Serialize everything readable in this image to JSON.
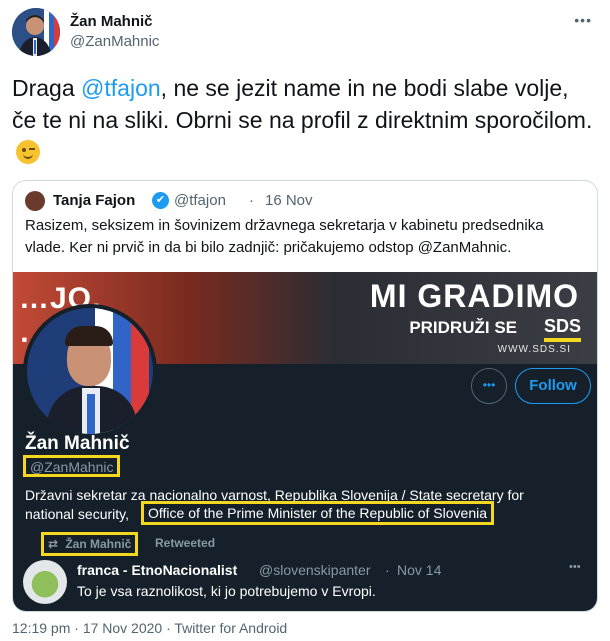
{
  "tweet": {
    "author_name": "Žan Mahnič",
    "author_handle": "@ZanMahnic",
    "more_label": "•••",
    "text_before": "Draga ",
    "mention": "@tfajon",
    "text_after": ", ne se jezit name in ne bodi slabe volje, če te ni na sliki. Obrni se na profil z direktnim sporočilom.",
    "footer": "12:19 pm · 17 Nov 2020 · Twitter for Android"
  },
  "quoted": {
    "author_name": "Tanja Fajon",
    "verified_icon": "✔",
    "author_handle": "@tfajon",
    "separator": "·",
    "date": "16 Nov",
    "text": "Rasizem, seksizem in šovinizem državnega sekretarja v kabinetu predsednika vlade. Ker ni prvič in da bi bilo zadnjič: pričakujemo odstop @ZanMahnic."
  },
  "embedded_profile": {
    "banner_left": "…JO,\n…EJO...",
    "banner_big": "MI GRADIMO",
    "banner_mid": "PRIDRUŽI SE",
    "banner_sds": "SDS",
    "banner_url": "WWW.SDS.SI",
    "more_button": "•••",
    "follow_button": "Follow",
    "name": "Žan Mahnič",
    "handle": "@ZanMahnic",
    "bio_line1": "Državni sekretar za nacionalno varnost, Republika Slovenija / State secretary for",
    "bio_line2a": "national security,",
    "bio_line2b": "Office of the Prime Minister of the Republic of Slovenia",
    "retweet_icon": "⇄",
    "retweet_by": "Žan Mahnič",
    "retweet_suffix": "Retweeted",
    "feed": {
      "name": "franca - EtnoNacionalist",
      "handle": "@slovenskipanter",
      "separator": "·",
      "date": "Nov 14",
      "more": "•••",
      "text": "To je vsa raznolikost, ki jo potrebujemo v Evropi."
    }
  },
  "icons": {
    "avatar": "avatar",
    "wink": "winking-face-emoji",
    "verified": "verified-badge-icon",
    "retweet": "retweet-icon"
  }
}
